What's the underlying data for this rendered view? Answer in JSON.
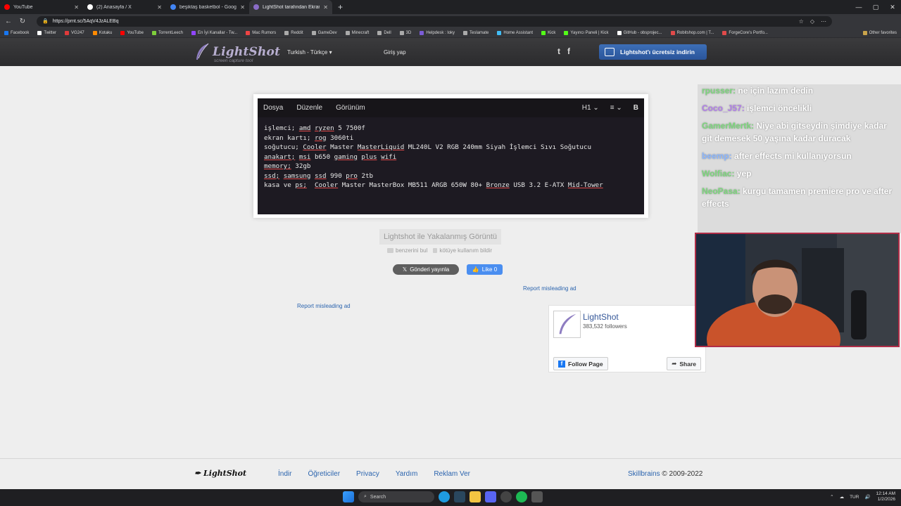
{
  "browser": {
    "tabs": [
      {
        "title": "YouTube",
        "color": "#ff0000",
        "active": false
      },
      {
        "title": "(2) Anasayfa / X",
        "color": "#ffffff",
        "active": false
      },
      {
        "title": "beşiktaş basketbol - Google Search",
        "color": "#4285f4",
        "active": false
      },
      {
        "title": "LightShot tarafından Ekran Görüntüsü",
        "color": "#8a6cc7",
        "active": true
      }
    ],
    "new_tab": "+",
    "url": "https://prnt.sc/5AqV4JzALEBq",
    "bookmarks": [
      {
        "label": "Facebook",
        "color": "#1877f2"
      },
      {
        "label": "Twitter",
        "color": "#ffffff"
      },
      {
        "label": "VG247",
        "color": "#e03a3a"
      },
      {
        "label": "Kotaku",
        "color": "#ff8a00"
      },
      {
        "label": "YouTube",
        "color": "#ff0000"
      },
      {
        "label": "TorrentLeech",
        "color": "#7ecf3b"
      },
      {
        "label": "En İyi Kanallar - Tw...",
        "color": "#9146ff"
      },
      {
        "label": "Mac Rumors",
        "color": "#e44"
      },
      {
        "label": "Reddit",
        "color": "#aaa"
      },
      {
        "label": "GameDev",
        "color": "#aaa"
      },
      {
        "label": "Minecraft",
        "color": "#aaa"
      },
      {
        "label": "Dell",
        "color": "#aaa"
      },
      {
        "label": "3D",
        "color": "#aaa"
      },
      {
        "label": "Helpdesk : loky",
        "color": "#7b5cd6"
      },
      {
        "label": "Teslamate",
        "color": "#aaa"
      },
      {
        "label": "Home Assistant",
        "color": "#41bdf5"
      },
      {
        "label": "Kick",
        "color": "#53fc18"
      },
      {
        "label": "Yayıncı Paneli | Kick",
        "color": "#53fc18"
      },
      {
        "label": "GitHub - obsprojec...",
        "color": "#ffffff"
      },
      {
        "label": "Robitshop.com | T...",
        "color": "#e04a4a"
      },
      {
        "label": "ForgeCore's Portfo...",
        "color": "#e04a4a"
      }
    ],
    "other_favorites": "Other favorites"
  },
  "header": {
    "logo_name": "LightShot",
    "logo_sub": "screen capture tool",
    "language": "Turkish - Türkçe",
    "login": "Giriş yap",
    "twitter_icon": "t",
    "facebook_icon": "f",
    "download_label": "Lightshot'ı ücretsiz indirin"
  },
  "editor": {
    "menu": [
      "Dosya",
      "Düzenle",
      "Görünüm"
    ],
    "heading_select": "H1",
    "list_icon": "≡",
    "bold_label": "B"
  },
  "code_lines": [
    "işlemci; amd ryzen 5 7500f",
    "ekran kartı; rog 3060ti",
    "soğutucu; Cooler Master MasterLiquid ML240L V2 RGB 240mm Siyah İşlemci Sıvı Soğutucu",
    "anakart; msi b650 gaming plus wifi",
    "memory; 32gb",
    "ssd; samsung ssd 990 pro 2tb",
    "kasa ve ps;  Cooler Master MasterBox MB511 ARGB 650W 80+ Bronze USB 3.2 E-ATX Mid-Tower"
  ],
  "caption": {
    "title": "Lightshot ile Yakalanmış Görüntü",
    "find_similar": "benzerini bul",
    "report_abuse": "kötüye kullanım bildir",
    "tweet": "Gönderi yayınla",
    "like": "Like 0",
    "report_ad_right": "Report misleading ad",
    "report_ad_left": "Report misleading ad"
  },
  "facebook": {
    "page_name": "LightShot",
    "followers": "383,532 followers",
    "follow": "Follow Page",
    "share": "Share"
  },
  "footer": {
    "logo": "LightShot",
    "links": [
      "İndir",
      "Öğreticiler",
      "Privacy",
      "Yardım",
      "Reklam Ver"
    ],
    "brand": "Skillbrains",
    "copyright": "© 2009-2022"
  },
  "chat": [
    {
      "user": "rpusser:",
      "text": "ne için lazım dedin",
      "color": "#7cd67c"
    },
    {
      "user": "Coco_J57:",
      "text": "işlemci öncelikli",
      "color": "#b07ee8"
    },
    {
      "user": "GamerMertk:",
      "text": "Niye abi gitseydin şimdiye kadar git demesek 50 yaşına kadar duracak",
      "color": "#7cd67c"
    },
    {
      "user": "beemp:",
      "text": "after effects mi kullanıyorsun",
      "color": "#8ab6ff"
    },
    {
      "user": "Wolfiac:",
      "text": "yep",
      "color": "#7cd67c"
    },
    {
      "user": "NeoPasa:",
      "text": "kurgu tamamen premiere pro ve after effects",
      "color": "#7cd67c"
    }
  ],
  "taskbar": {
    "search": "Search",
    "lang": "TUR",
    "time": "12:14 AM",
    "date": "1/2/2026"
  }
}
